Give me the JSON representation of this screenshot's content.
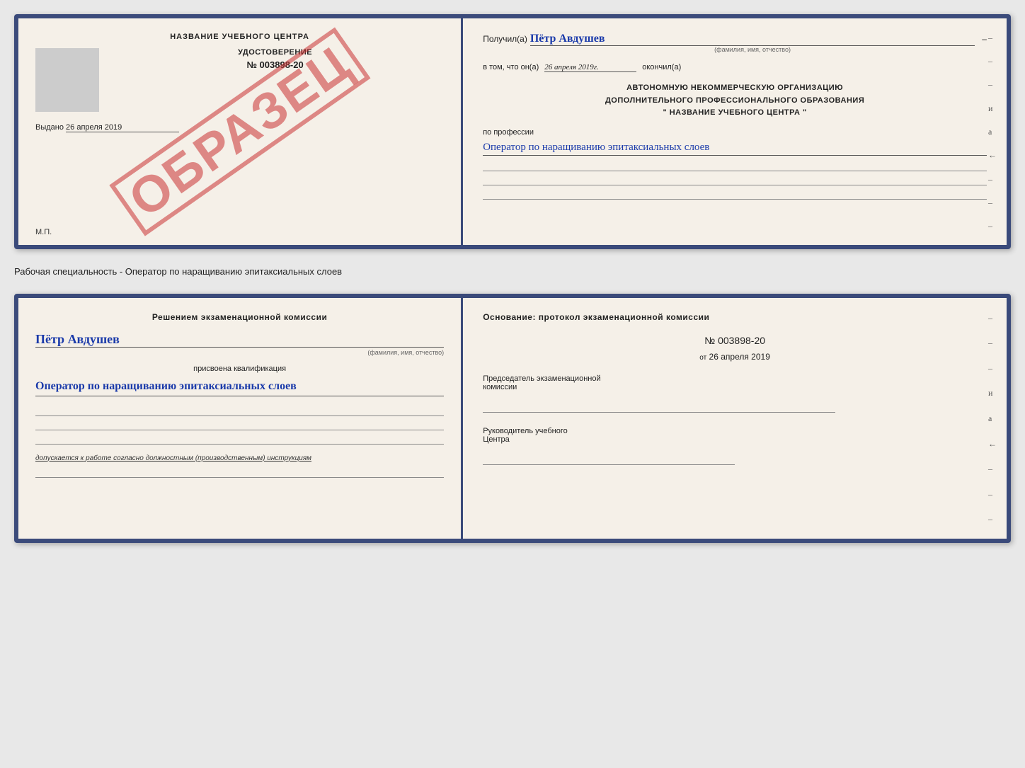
{
  "page": {
    "background": "#e8e8e8"
  },
  "cert1": {
    "left": {
      "title": "НАЗВАНИЕ УЧЕБНОГО ЦЕНТРА",
      "stamp_alt": "М.П.",
      "label": "УДОСТОВЕРЕНИЕ",
      "number": "№ 003898-20",
      "obrazets": "ОБРАЗЕЦ",
      "issued_prefix": "Выдано",
      "issued_date": "26 апреля 2019",
      "mp": "М.П."
    },
    "right": {
      "recipient_prefix": "Получил(а)",
      "recipient_name": "Пётр Авдушев",
      "recipient_sub": "(фамилия, имя, отчество)",
      "date_prefix": "в том, что он(а)",
      "date_value": "26 апреля 2019г.",
      "okoncil": "окончил(а)",
      "org_line1": "АВТОНОМНУЮ НЕКОММЕРЧЕСКУЮ ОРГАНИЗАЦИЮ",
      "org_line2": "ДОПОЛНИТЕЛЬНОГО ПРОФЕССИОНАЛЬНОГО ОБРАЗОВАНИЯ",
      "org_line3": "\" НАЗВАНИЕ УЧЕБНОГО ЦЕНТРА \"",
      "profession_label": "по профессии",
      "profession_value": "Оператор по наращиванию эпитаксиальных слоев"
    }
  },
  "middle": {
    "label": "Рабочая специальность - Оператор по наращиванию эпитаксиальных слоев"
  },
  "cert2": {
    "left": {
      "decision_title": "Решением экзаменационной комиссии",
      "name": "Пётр Авдушев",
      "name_sub": "(фамилия, имя, отчество)",
      "assigned": "присвоена квалификация",
      "qualification": "Оператор по наращиванию эпитаксиальных слоев",
      "allowed_prefix": "допускается к",
      "allowed_text": "работе согласно должностным (производственным) инструкциям"
    },
    "right": {
      "osnov_title": "Основание: протокол экзаменационной комиссии",
      "prot_number": "№ 003898-20",
      "ot_prefix": "от",
      "prot_date": "26 апреля 2019",
      "predsedatel_label1": "Председатель экзаменационной",
      "predsedatel_label2": "комиссии",
      "ruk_label1": "Руководитель учебного",
      "ruk_label2": "Центра"
    }
  },
  "dashes": [
    "-",
    "-",
    "-",
    "и",
    "а",
    "←",
    "-",
    "-",
    "-"
  ]
}
